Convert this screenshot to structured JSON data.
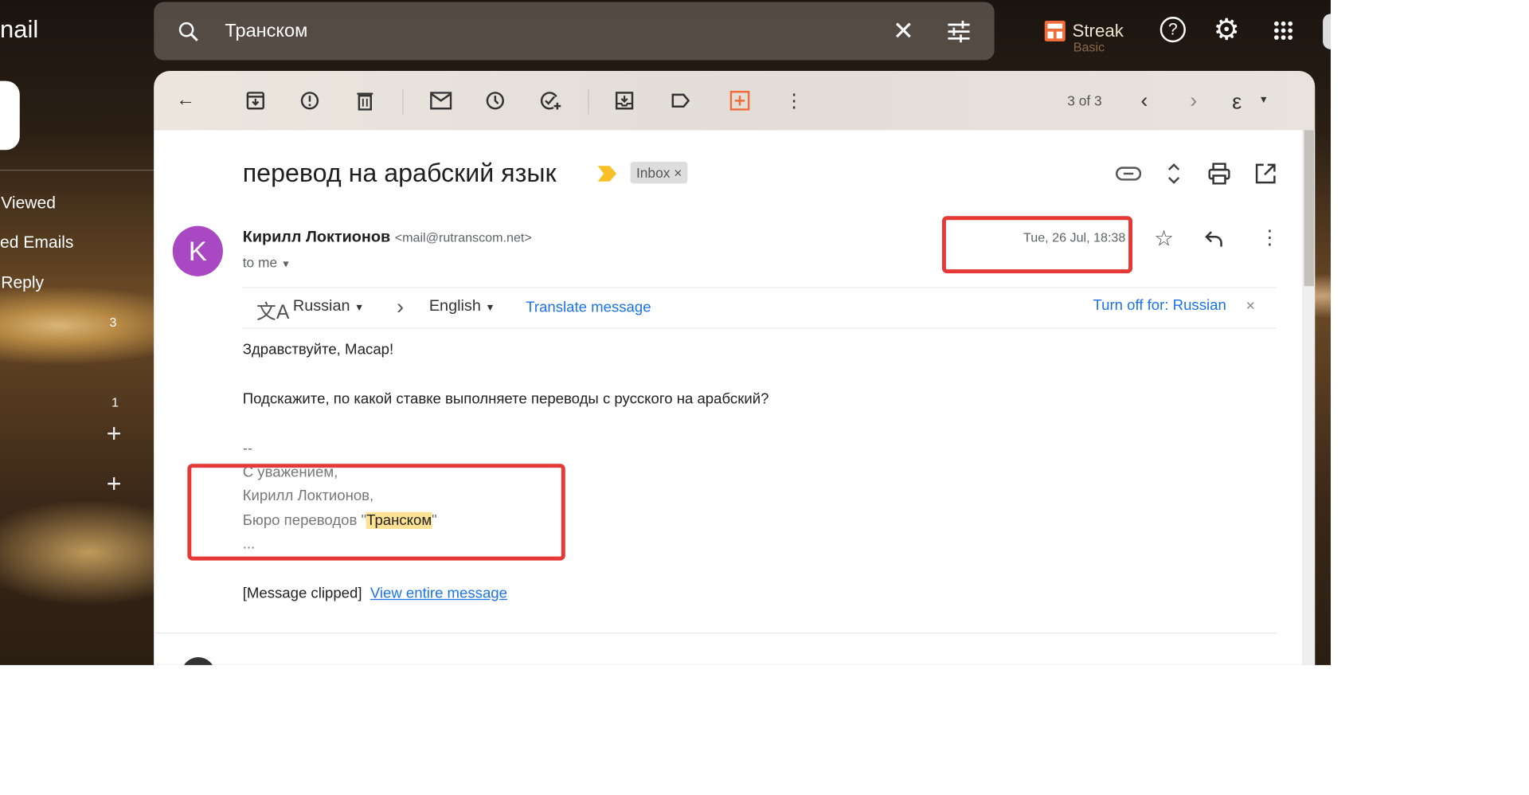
{
  "app": {
    "logo_text": "nail"
  },
  "sidebar": {
    "items": [
      {
        "label": "Viewed"
      },
      {
        "label": "ed Emails"
      },
      {
        "label": "Reply"
      }
    ],
    "counts": [
      "3",
      "1"
    ]
  },
  "search": {
    "value": "Транском"
  },
  "header": {
    "streak_label": "Streak",
    "streak_plan": "Basic"
  },
  "toolbar": {
    "pagination": "3 of 3",
    "input_tool": "ε"
  },
  "thread": {
    "subject": "перевод на арабский язык",
    "label_chip": "Inbox",
    "label_chip_close": "×"
  },
  "message": {
    "avatar_letter": "K",
    "avatar_color": "#a848c3",
    "sender_name": "Кирилл Локтионов",
    "sender_email": "<mail@rutranscom.net>",
    "recipient": "to me",
    "date": "Tue, 26 Jul, 18:38",
    "translate": {
      "from": "Russian",
      "to": "English",
      "action": "Translate message",
      "turn_off": "Turn off for: Russian",
      "close": "×"
    },
    "body": {
      "greeting": "Здравствуйте, Масар!",
      "question": "Подскажите, по какой ставке выполняете переводы с русского на арабский?",
      "sig_sep": "--",
      "sig_1": "С уважением,",
      "sig_2": "Кирилл Локтионов,",
      "sig_3_prefix": "Бюро переводов \"",
      "sig_3_highlight": "Транском",
      "sig_3_suffix": "\"",
      "ellipsis": "..."
    },
    "clipped_text": "[Message clipped]",
    "view_entire": "View entire message"
  },
  "colors": {
    "annotation_red": "#e53935",
    "highlight": "#fde293",
    "link": "#1a73e8",
    "streak_orange": "#f26b3a"
  }
}
